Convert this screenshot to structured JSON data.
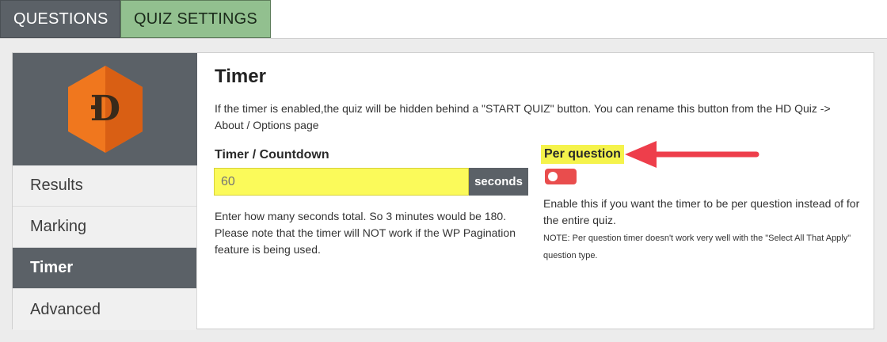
{
  "tabs": [
    {
      "label": "QUESTIONS"
    },
    {
      "label": "QUIZ SETTINGS"
    }
  ],
  "logo": {
    "letter": "D",
    "colors": {
      "outer": "#f0771e",
      "inner": "#d95f14"
    }
  },
  "sidebar": {
    "items": [
      {
        "label": "Results"
      },
      {
        "label": "Marking"
      },
      {
        "label": "Timer"
      },
      {
        "label": "Advanced"
      }
    ],
    "active_index": 2
  },
  "content": {
    "title": "Timer",
    "intro": "If the timer is enabled,the quiz will be hidden behind a \"START QUIZ\" button. You can rename this button from the HD Quiz -> About / Options page",
    "timer": {
      "label": "Timer / Countdown",
      "placeholder": "60",
      "suffix": "seconds",
      "help": "Enter how many seconds total. So 3 minutes would be 180. Please note that the timer will NOT work if the WP Pagination feature is being used."
    },
    "per_question": {
      "label": "Per question",
      "toggle_on": false,
      "help": "Enable this if you want the timer to be per question instead of for the entire quiz.",
      "note": "NOTE: Per question timer doesn't work very well with the \"Select All That Apply\" question type."
    }
  },
  "colors": {
    "tab_questions": "#5b6167",
    "tab_settings": "#92c08f",
    "highlight_yellow": "#f5f34b",
    "toggle_red": "#e94d4d",
    "arrow_red": "#ee3e4b"
  }
}
